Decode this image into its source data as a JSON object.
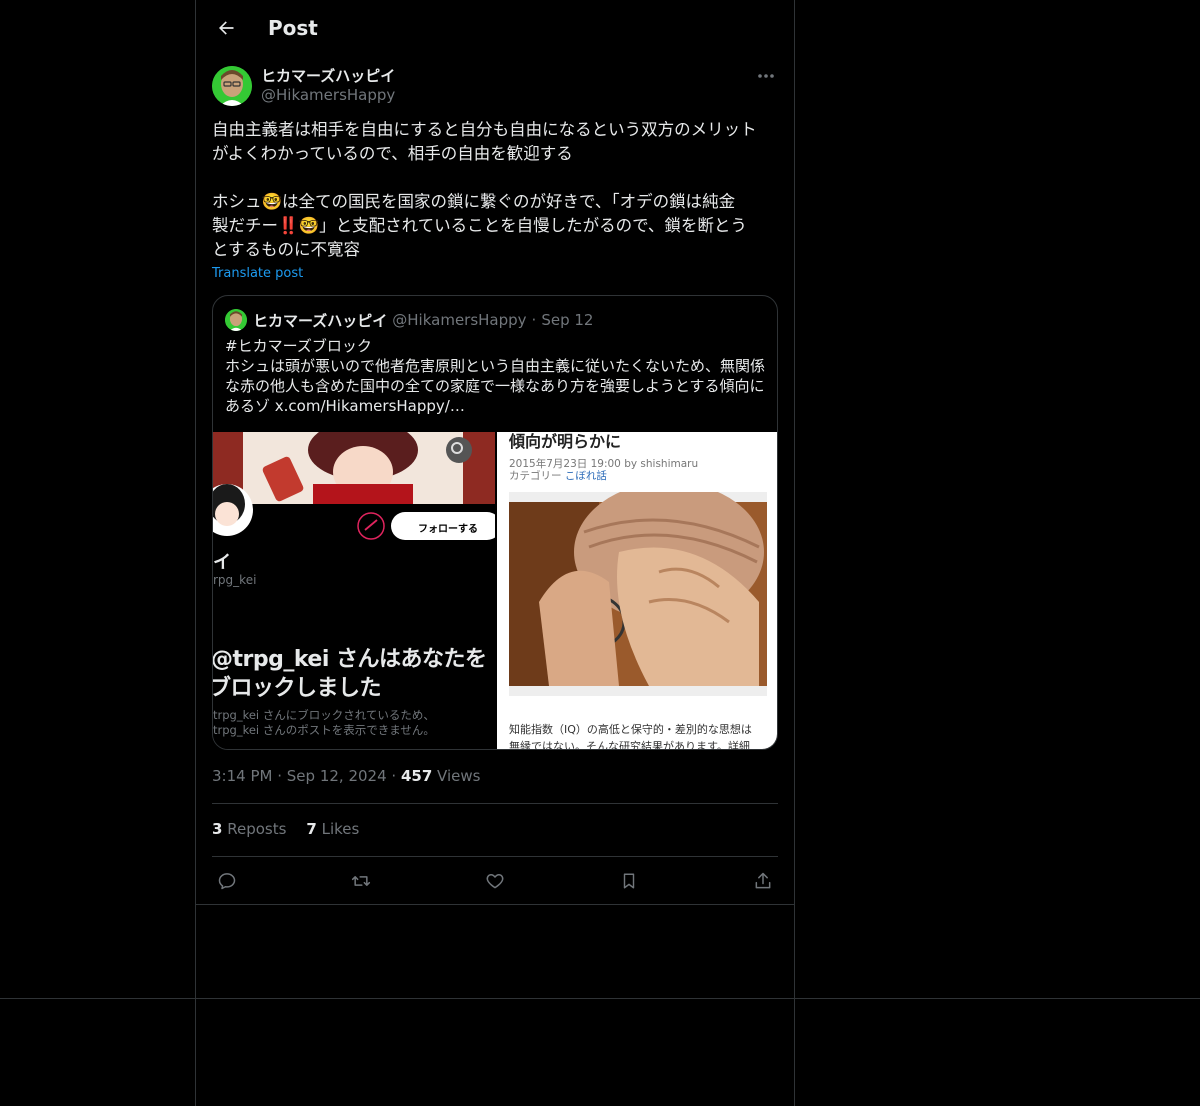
{
  "header": {
    "title": "Post",
    "back_icon": "arrow-left-icon"
  },
  "post": {
    "display_name": "ヒカマーズハッピイ",
    "handle": "@HikamersHappy",
    "more_icon": "more-horizontal-icon",
    "text": "自由主義者は相手を自由にすると自分も自由になるという双方のメリット\nがよくわかっているので、相手の自由を歓迎する\n\nホシュ🤓は全ての国民を国家の鎖に繋ぐのが好きで、「オデの鎖は純金\n製だチー‼️🤓」と支配されていることを自慢したがるので、鎖を断とう\nとするものに不寛容",
    "translate_label": "Translate post",
    "time": "3:14 PM",
    "date": "Sep 12, 2024",
    "views_count": "457",
    "views_label": "Views",
    "reposts_count": "3",
    "reposts_label": "Reposts",
    "likes_count": "7",
    "likes_label": "Likes"
  },
  "quote": {
    "display_name": "ヒカマーズハッピイ",
    "handle": "@HikamersHappy",
    "date": "Sep 12",
    "text": "#ヒカマーズブロック\nホシュは頭が悪いので他者危害原則という自由主義に従いたくないため、無関係\nな赤の他人も含めた国中の全ての家庭で一様なあり方を強要しようとする傾向に\nあるゾ x.com/HikamersHappy/…",
    "left_image": {
      "follow_label": "フォローする",
      "name_fragment": "イ",
      "handle_fragment": "rpg_kei",
      "blocked_line1": "@trpg_kei さんはあなたを",
      "blocked_line2": "ブロックしました",
      "blocked_sub1": "trpg_kei さんにブロックされているため、",
      "blocked_sub2": "trpg_kei さんのポストを表示できません。"
    },
    "right_image": {
      "headline": "傾向が明らかに",
      "byline": "2015年7月23日 19:00 by shishimaru",
      "category_label": "カテゴリー",
      "category_link": "こぼれ話",
      "caption_line1": "知能指数（IQ）の高低と保守的・差別的な思想は",
      "caption_line2": "無縁ではない。そんな研究結果があります。詳細"
    }
  },
  "actions": [
    "reply-icon",
    "repost-icon",
    "like-icon",
    "bookmark-icon",
    "share-icon"
  ],
  "colors": {
    "background": "#000000",
    "text": "#e7e9ea",
    "muted": "#71767b",
    "accent": "#1d9bf0",
    "border": "#2f3336"
  }
}
